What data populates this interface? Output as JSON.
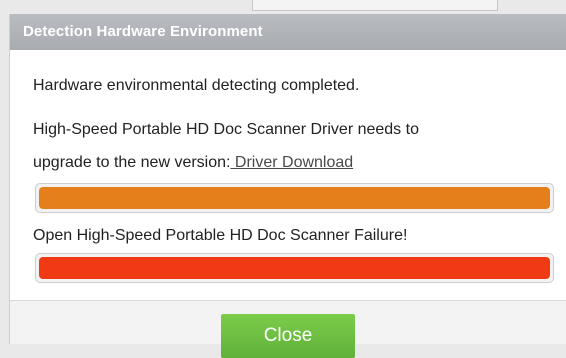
{
  "dialog": {
    "title": "Detection Hardware Environment",
    "status_message": "Hardware environmental detecting completed.",
    "driver_message_line1": "High-Speed Portable HD Doc Scanner Driver needs to",
    "driver_message_line2": "upgrade to the new version:",
    "driver_link": " Driver Download",
    "driver_bar": {
      "color": "#e47f1c",
      "progress": 1.0
    },
    "open_failure_message": "Open High-Speed Portable HD Doc Scanner Failure!",
    "failure_bar": {
      "color": "#f03a14",
      "progress": 1.0
    },
    "close_label": "Close"
  },
  "colors": {
    "titlebar": "#aeb1b5",
    "close_button": "#6dbe40"
  }
}
